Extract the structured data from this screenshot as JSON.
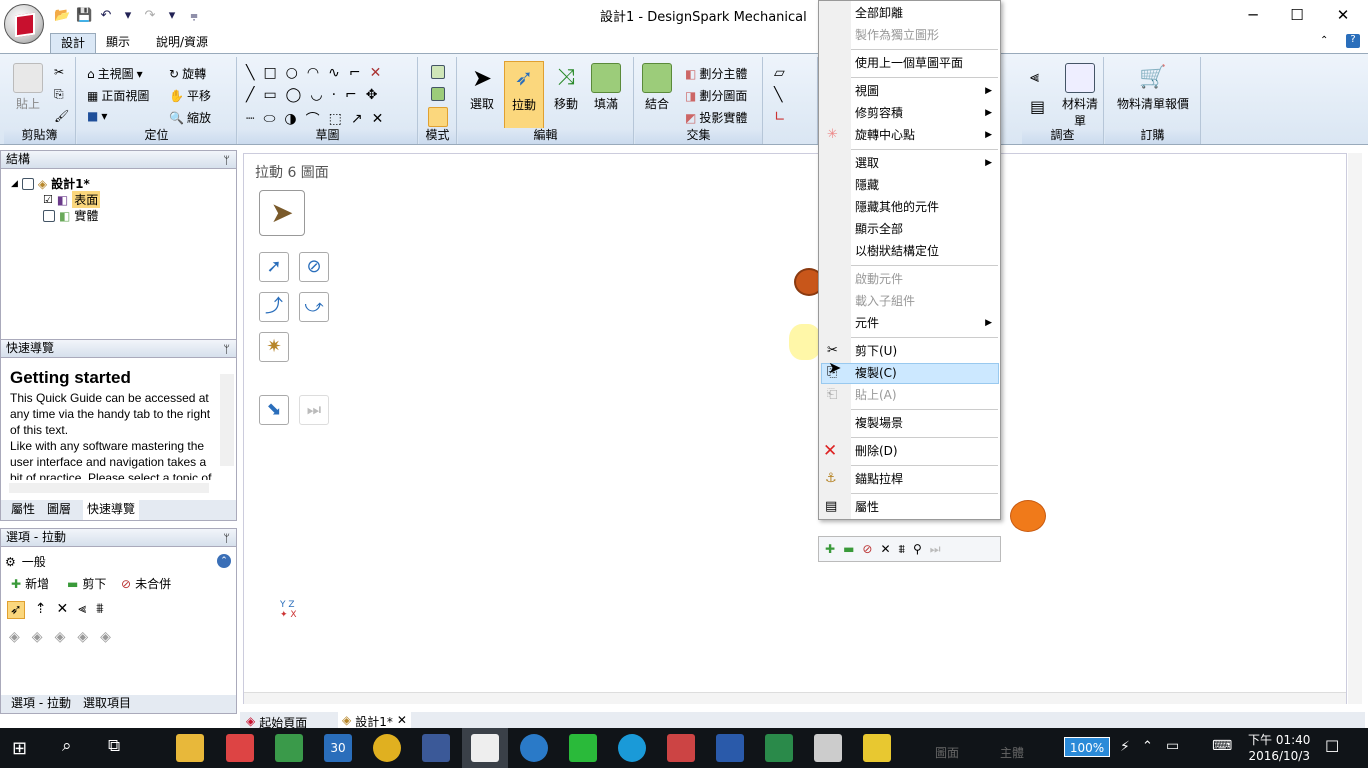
{
  "window": {
    "title": "設計1 - DesignSpark Mechanical",
    "minimize": "─",
    "maximize": "☐",
    "close": "✕"
  },
  "tabs": [
    "設計",
    "顯示",
    "說明/資源"
  ],
  "ribbon": {
    "clipboard": {
      "label": "剪貼簿",
      "paste": "貼上"
    },
    "orient": {
      "label": "定位",
      "home": "主視圖",
      "front": "正面視圖",
      "rotate": "旋轉",
      "pan": "平移",
      "zoom": "縮放"
    },
    "sketch": {
      "label": "草圖"
    },
    "mode": {
      "label": "模式"
    },
    "edit": {
      "label": "編輯",
      "select": "選取",
      "pull": "拉動",
      "move": "移動",
      "fill": "填滿"
    },
    "intersect": {
      "label": "交集",
      "combine": "結合",
      "split_body": "劃分主體",
      "split_face": "劃分圖面",
      "project": "投影實體"
    },
    "inspect": {
      "label": "調查",
      "bom": "材料清單"
    },
    "order": {
      "label": "訂購",
      "bom_quote": "物料清單報價"
    }
  },
  "structure": {
    "title": "結構",
    "root": "設計1*",
    "items": [
      "表面",
      "實體"
    ]
  },
  "quickguide": {
    "title": "快速導覽",
    "heading": "Getting started",
    "lines": [
      "This Quick Guide can be accessed at",
      "any time via the handy tab to the right",
      "of this text.",
      "Like with any software mastering the",
      "user interface and navigation takes a",
      "bit of practice. Please select a topic of"
    ],
    "tabs": [
      "屬性",
      "圖層",
      "快速導覽"
    ]
  },
  "options": {
    "title": "選項 - 拉動",
    "general": "一般",
    "add": "新增",
    "cut": "剪下",
    "nomerge": "未合併"
  },
  "bottom_tabs": [
    "選項 - 拉動",
    "選取項目"
  ],
  "canvas": {
    "status": "拉動 6 圖面",
    "doc_tabs": [
      "起始頁面",
      "設計1*"
    ]
  },
  "context_menu": {
    "items": [
      {
        "label": "全部卸離",
        "disabled": false
      },
      {
        "label": "製作為獨立圖形",
        "disabled": true
      },
      {
        "label": "使用上一個草圖平面",
        "disabled": false
      },
      {
        "label": "視圖",
        "disabled": false,
        "sub": true
      },
      {
        "label": "修剪容積",
        "disabled": false,
        "sub": true
      },
      {
        "label": "旋轉中心點",
        "disabled": false,
        "sub": true
      },
      {
        "label": "選取",
        "disabled": false,
        "sub": true
      },
      {
        "label": "隱藏",
        "disabled": false
      },
      {
        "label": "隱藏其他的元件",
        "disabled": false
      },
      {
        "label": "顯示全部",
        "disabled": false
      },
      {
        "label": "以樹狀結構定位",
        "disabled": false
      },
      {
        "label": "啟動元件",
        "disabled": true
      },
      {
        "label": "載入子組件",
        "disabled": true
      },
      {
        "label": "元件",
        "disabled": false,
        "sub": true
      },
      {
        "label": "剪下(U)",
        "disabled": false
      },
      {
        "label": "複製(C)",
        "disabled": false,
        "highlighted": true
      },
      {
        "label": "貼上(A)",
        "disabled": true
      },
      {
        "label": "複製場景",
        "disabled": false
      },
      {
        "label": "刪除(D)",
        "disabled": false
      },
      {
        "label": "錨點拉桿",
        "disabled": false
      },
      {
        "label": "屬性",
        "disabled": false
      }
    ]
  },
  "taskbar": {
    "calendar_day": "30",
    "battery": "100%",
    "time": "下午 01:40",
    "date": "2016/10/3",
    "labels": [
      "圖面",
      "主體"
    ]
  },
  "colors": {
    "accent": "#c8102e",
    "highlight": "#cce8ff",
    "ribbon": "#dae6f3"
  }
}
